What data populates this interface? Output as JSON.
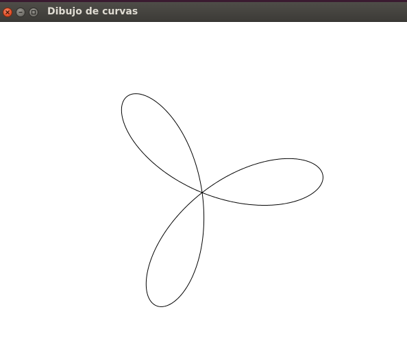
{
  "window": {
    "title": "Dibujo de curvas"
  },
  "titlebar_buttons": {
    "close_icon": "close-icon",
    "minimize_icon": "minimize-icon",
    "maximize_icon": "maximize-icon"
  },
  "drawing": {
    "shape": "three-leaf rose curve",
    "petals": 3,
    "stroke_color": "#000000",
    "background_color": "#ffffff"
  }
}
